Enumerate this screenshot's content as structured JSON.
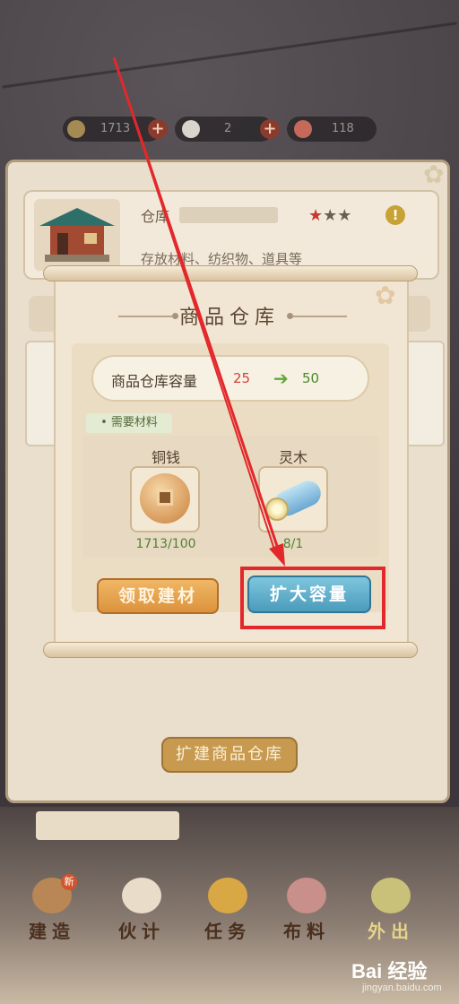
{
  "resources": {
    "coins": "1713",
    "second_value": "2",
    "third_value": "118"
  },
  "building_card": {
    "title": "仓库",
    "description": "存放材料、纺织物、道具等",
    "stars_filled": 1,
    "stars_total": 3,
    "info_symbol": "!"
  },
  "back_panel": {
    "expand_button_label": "扩建商品仓库"
  },
  "dialog": {
    "title": "商品仓库",
    "capacity_label": "商品仓库容量",
    "capacity_from": "25",
    "capacity_to": "50",
    "materials_tag": "• 需要材料",
    "materials": [
      {
        "name": "铜钱",
        "count": "1713/100",
        "icon": "coin-icon"
      },
      {
        "name": "灵木",
        "count": "8/1",
        "icon": "wood-log-icon"
      }
    ],
    "collect_button_label": "领取建材",
    "expand_button_label": "扩大容量"
  },
  "bottom_nav": {
    "items": [
      {
        "label": "建造",
        "icon": "build-icon",
        "badge": "新"
      },
      {
        "label": "伙计",
        "icon": "staff-icon"
      },
      {
        "label": "任务",
        "icon": "task-icon"
      },
      {
        "label": "布料",
        "icon": "cloth-icon"
      },
      {
        "label": "外出",
        "icon": "outing-icon"
      }
    ]
  },
  "colors": {
    "highlight": "#e3282b",
    "expand_button": "#4b9bbc",
    "collect_button": "#dc923c"
  },
  "watermark": {
    "brand": "Bai 经验",
    "url": "jingyan.baidu.com"
  }
}
